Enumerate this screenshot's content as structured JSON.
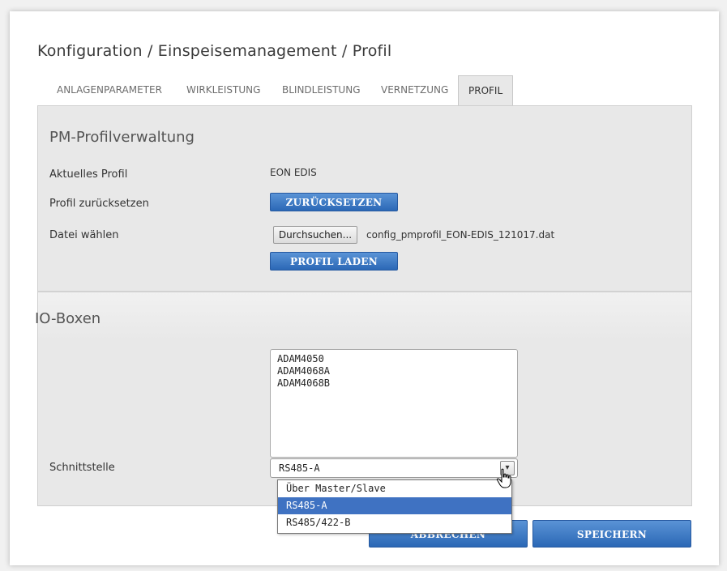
{
  "breadcrumb": "Konfiguration / Einspeisemanagement / Profil",
  "tabs": [
    {
      "label": "ANLAGENPARAMETER",
      "active": false
    },
    {
      "label": "WIRKLEISTUNG",
      "active": false
    },
    {
      "label": "BLINDLEISTUNG",
      "active": false
    },
    {
      "label": "VERNETZUNG",
      "active": false
    },
    {
      "label": "PROFIL",
      "active": true
    }
  ],
  "profile_section": {
    "title": "PM-Profilverwaltung",
    "current_profile_label": "Aktuelles Profil",
    "current_profile_value": "EON EDIS",
    "reset_label": "Profil zurücksetzen",
    "reset_button": "ZURÜCKSETZEN",
    "file_label": "Datei wählen",
    "browse_button": "Durchsuchen...",
    "file_name": "config_pmprofil_EON-EDIS_121017.dat",
    "load_button": "PROFIL LADEN"
  },
  "io_section": {
    "title": "IO-Boxen",
    "list_items": [
      "ADAM4050",
      "ADAM4068A",
      "ADAM4068B"
    ],
    "interface_label": "Schnittstelle",
    "interface_value": "RS485-A",
    "interface_options": [
      "Über Master/Slave",
      "RS485-A",
      "RS485/422-B"
    ],
    "selected_option_index": 1
  },
  "footer": {
    "cancel_button": "ABBRECHEN",
    "save_button": "SPEICHERN"
  },
  "colors": {
    "accent": "#2b68b6",
    "selected_option": "#3f72c2",
    "panel": "#e8e8e8"
  }
}
